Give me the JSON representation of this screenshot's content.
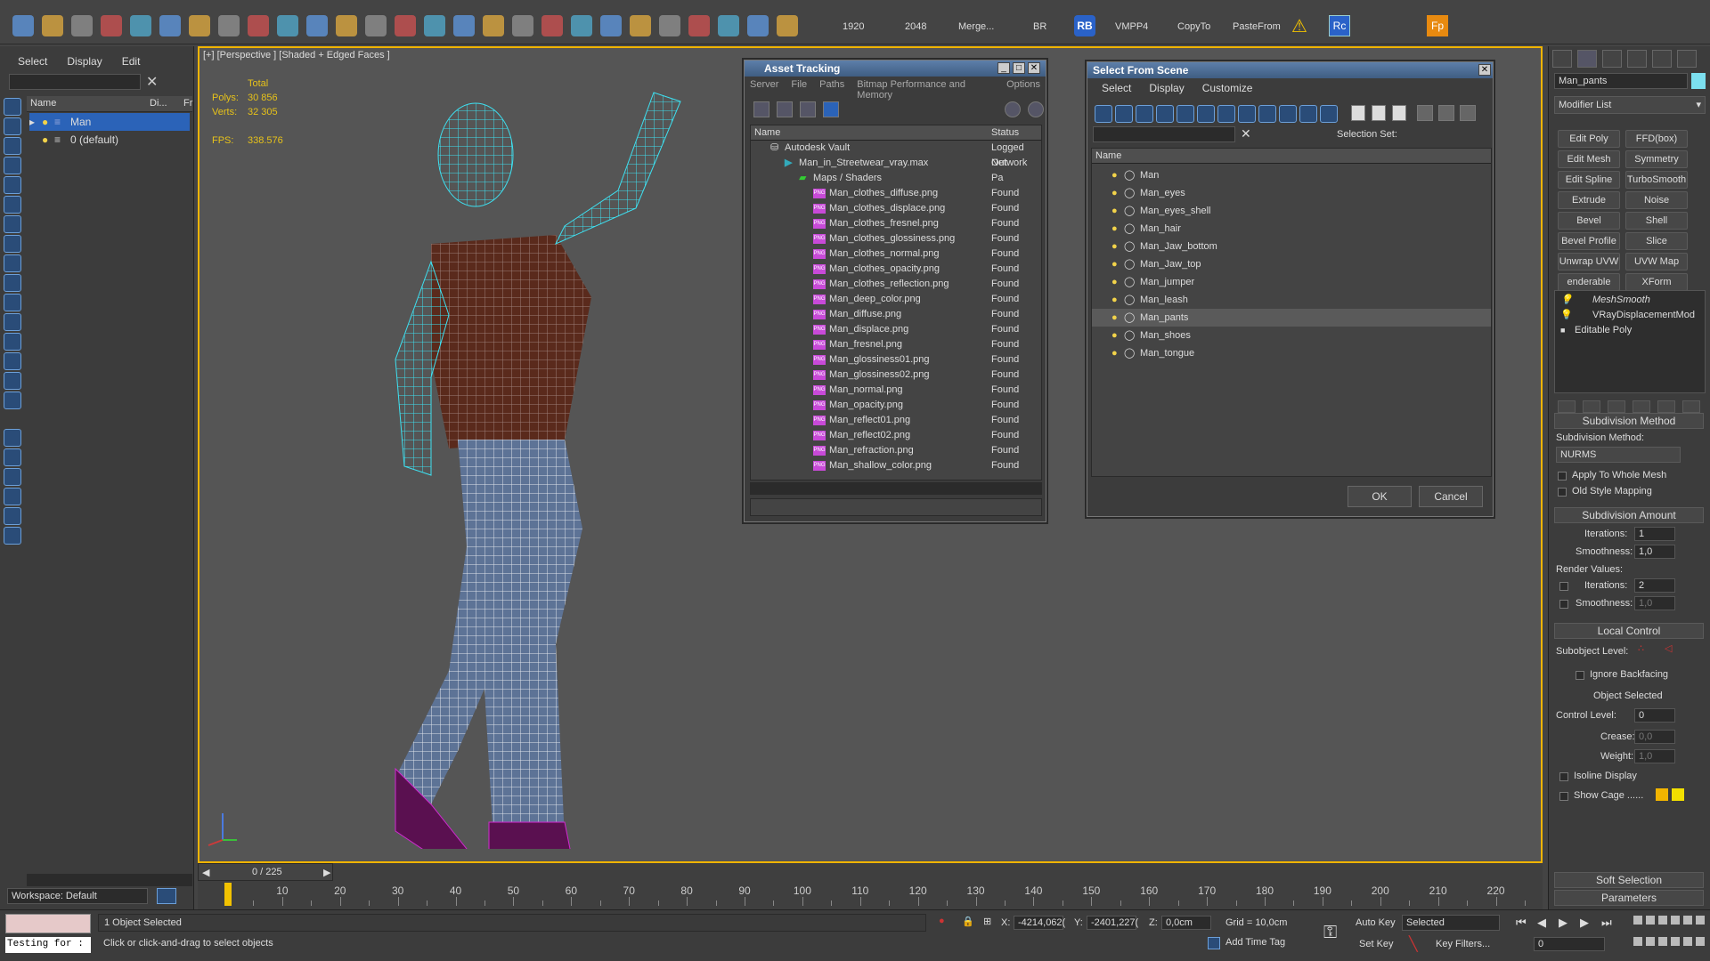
{
  "toolbar": {
    "res_w": "1920",
    "res_h": "2048",
    "merge": "Merge...",
    "br": "BR",
    "rb": "RB",
    "vmpp4": "VMPP4",
    "copyto": "CopyTo",
    "pastefrom": "PasteFrom",
    "rc": "Rc",
    "fp": "Fp"
  },
  "scene_explorer": {
    "menu": [
      "Select",
      "Display",
      "Edit"
    ],
    "col_name": "Name",
    "col_display": "Di...",
    "col_fr": "Fr",
    "items": [
      "Man",
      "0 (default)"
    ],
    "workspace": "Workspace: Default"
  },
  "viewport": {
    "label": "[+] [Perspective ] [Shaded + Edged Faces ]",
    "total": "Total",
    "polys_label": "Polys:",
    "polys": "30 856",
    "verts_label": "Verts:",
    "verts": "32 305",
    "fps_label": "FPS:",
    "fps": "338.576"
  },
  "timeline": {
    "frame": "0 / 225",
    "ticks": [
      "10",
      "20",
      "30",
      "40",
      "50",
      "60",
      "70",
      "80",
      "90",
      "100",
      "110",
      "120",
      "130",
      "140",
      "150",
      "160",
      "170",
      "180",
      "190",
      "200",
      "210",
      "220"
    ]
  },
  "asset_tracking": {
    "title": "Asset Tracking",
    "menu": [
      "Server",
      "File",
      "Paths",
      "Bitmap Performance and Memory",
      "Options"
    ],
    "col_name": "Name",
    "col_status": "Status",
    "vault": "Autodesk Vault",
    "vault_status": "Logged Out",
    "file": "Man_in_Streetwear_vray.max",
    "file_status": "Network Pa",
    "maps": "Maps / Shaders",
    "assets": [
      "Man_clothes_diffuse.png",
      "Man_clothes_displace.png",
      "Man_clothes_fresnel.png",
      "Man_clothes_glossiness.png",
      "Man_clothes_normal.png",
      "Man_clothes_opacity.png",
      "Man_clothes_reflection.png",
      "Man_deep_color.png",
      "Man_diffuse.png",
      "Man_displace.png",
      "Man_fresnel.png",
      "Man_glossiness01.png",
      "Man_glossiness02.png",
      "Man_normal.png",
      "Man_opacity.png",
      "Man_reflect01.png",
      "Man_reflect02.png",
      "Man_refraction.png",
      "Man_shallow_color.png"
    ],
    "found": "Found"
  },
  "select_from_scene": {
    "title": "Select From Scene",
    "menu": [
      "Select",
      "Display",
      "Customize"
    ],
    "selection_set": "Selection Set:",
    "col_name": "Name",
    "objects": [
      "Man",
      "Man_eyes",
      "Man_eyes_shell",
      "Man_hair",
      "Man_Jaw_bottom",
      "Man_Jaw_top",
      "Man_jumper",
      "Man_leash",
      "Man_pants",
      "Man_shoes",
      "Man_tongue"
    ],
    "ok": "OK",
    "cancel": "Cancel"
  },
  "command_panel": {
    "object_name": "Man_pants",
    "modifier_list": "Modifier List",
    "buttons": [
      "Edit Poly",
      "FFD(box)",
      "Edit Mesh",
      "Symmetry",
      "Edit Spline",
      "TurboSmooth",
      "Extrude",
      "Noise",
      "Bevel",
      "Shell",
      "Bevel Profile",
      "Slice",
      "Unwrap UVW",
      "UVW Map",
      "enderable Spli",
      "XForm"
    ],
    "stack": [
      "MeshSmooth",
      "VRayDisplacementMod",
      "Editable Poly"
    ],
    "subdiv_method_hdr": "Subdivision Method",
    "subdiv_method_label": "Subdivision Method:",
    "subdiv_method": "NURMS",
    "apply_whole": "Apply To Whole Mesh",
    "old_style": "Old Style Mapping",
    "subdiv_amount_hdr": "Subdivision Amount",
    "iterations_label": "Iterations:",
    "iterations": "1",
    "smoothness_label": "Smoothness:",
    "smoothness": "1,0",
    "render_values": "Render Values:",
    "r_iterations": "2",
    "r_smoothness": "1,0",
    "local_control_hdr": "Local Control",
    "subobject_level": "Subobject Level:",
    "ignore_backfacing": "Ignore Backfacing",
    "object_selected": "Object Selected",
    "control_level_label": "Control Level:",
    "control_level": "0",
    "crease_label": "Crease:",
    "crease": "0,0",
    "weight_label": "Weight:",
    "weight": "1,0",
    "isoline": "Isoline Display",
    "show_cage": "Show Cage ......",
    "soft_selection_hdr": "Soft Selection",
    "parameters_hdr": "Parameters"
  },
  "status": {
    "testing": "Testing for :",
    "selected": "1 Object Selected",
    "prompt": "Click or click-and-drag to select objects",
    "x_label": "X:",
    "x": "-4214,062(",
    "y_label": "Y:",
    "y": "-2401,227(",
    "z_label": "Z:",
    "z": "0,0cm",
    "grid": "Grid = 10,0cm",
    "add_time_tag": "Add Time Tag",
    "auto_key": "Auto Key",
    "set_key": "Set Key",
    "selected_dd": "Selected",
    "key_filters": "Key Filters...",
    "frame_field": "0"
  }
}
